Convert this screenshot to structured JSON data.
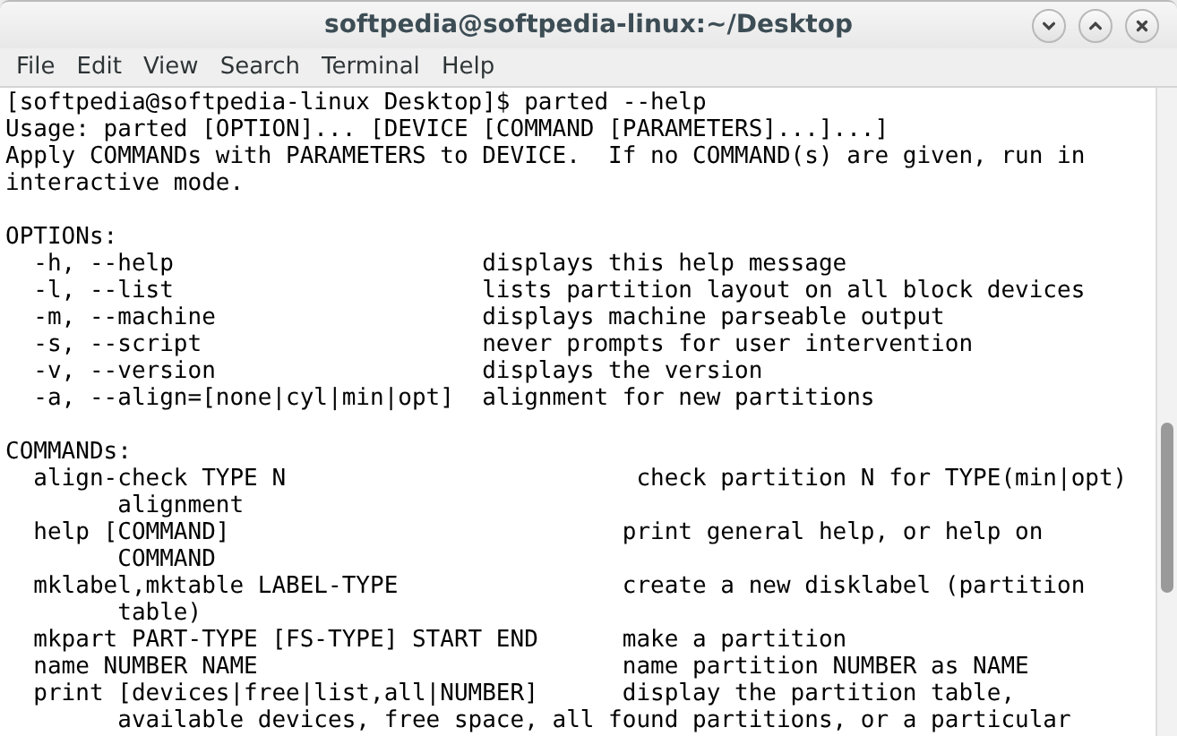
{
  "window": {
    "title": "softpedia@softpedia-linux:~/Desktop"
  },
  "menu": [
    "File",
    "Edit",
    "View",
    "Search",
    "Terminal",
    "Help"
  ],
  "terminal": {
    "blocks": [
      [
        "[softpedia@softpedia-linux Desktop]$ parted --help",
        "Usage: parted [OPTION]... [DEVICE [COMMAND [PARAMETERS]...]...]",
        "Apply COMMANDs with PARAMETERS to DEVICE.  If no COMMAND(s) are given, run in",
        "interactive mode."
      ],
      [
        "OPTIONs:",
        "  -h, --help                      displays this help message",
        "  -l, --list                      lists partition layout on all block devices",
        "  -m, --machine                   displays machine parseable output",
        "  -s, --script                    never prompts for user intervention",
        "  -v, --version                   displays the version",
        "  -a, --align=[none|cyl|min|opt]  alignment for new partitions"
      ],
      [
        "COMMANDs:",
        "  align-check TYPE N                         check partition N for TYPE(min|opt)",
        "        alignment",
        "  help [COMMAND]                            print general help, or help on",
        "        COMMAND",
        "  mklabel,mktable LABEL-TYPE                create a new disklabel (partition",
        "        table)",
        "  mkpart PART-TYPE [FS-TYPE] START END      make a partition",
        "  name NUMBER NAME                          name partition NUMBER as NAME",
        "  print [devices|free|list,all|NUMBER]      display the partition table,",
        "        available devices, free space, all found partitions, or a particular"
      ]
    ]
  }
}
